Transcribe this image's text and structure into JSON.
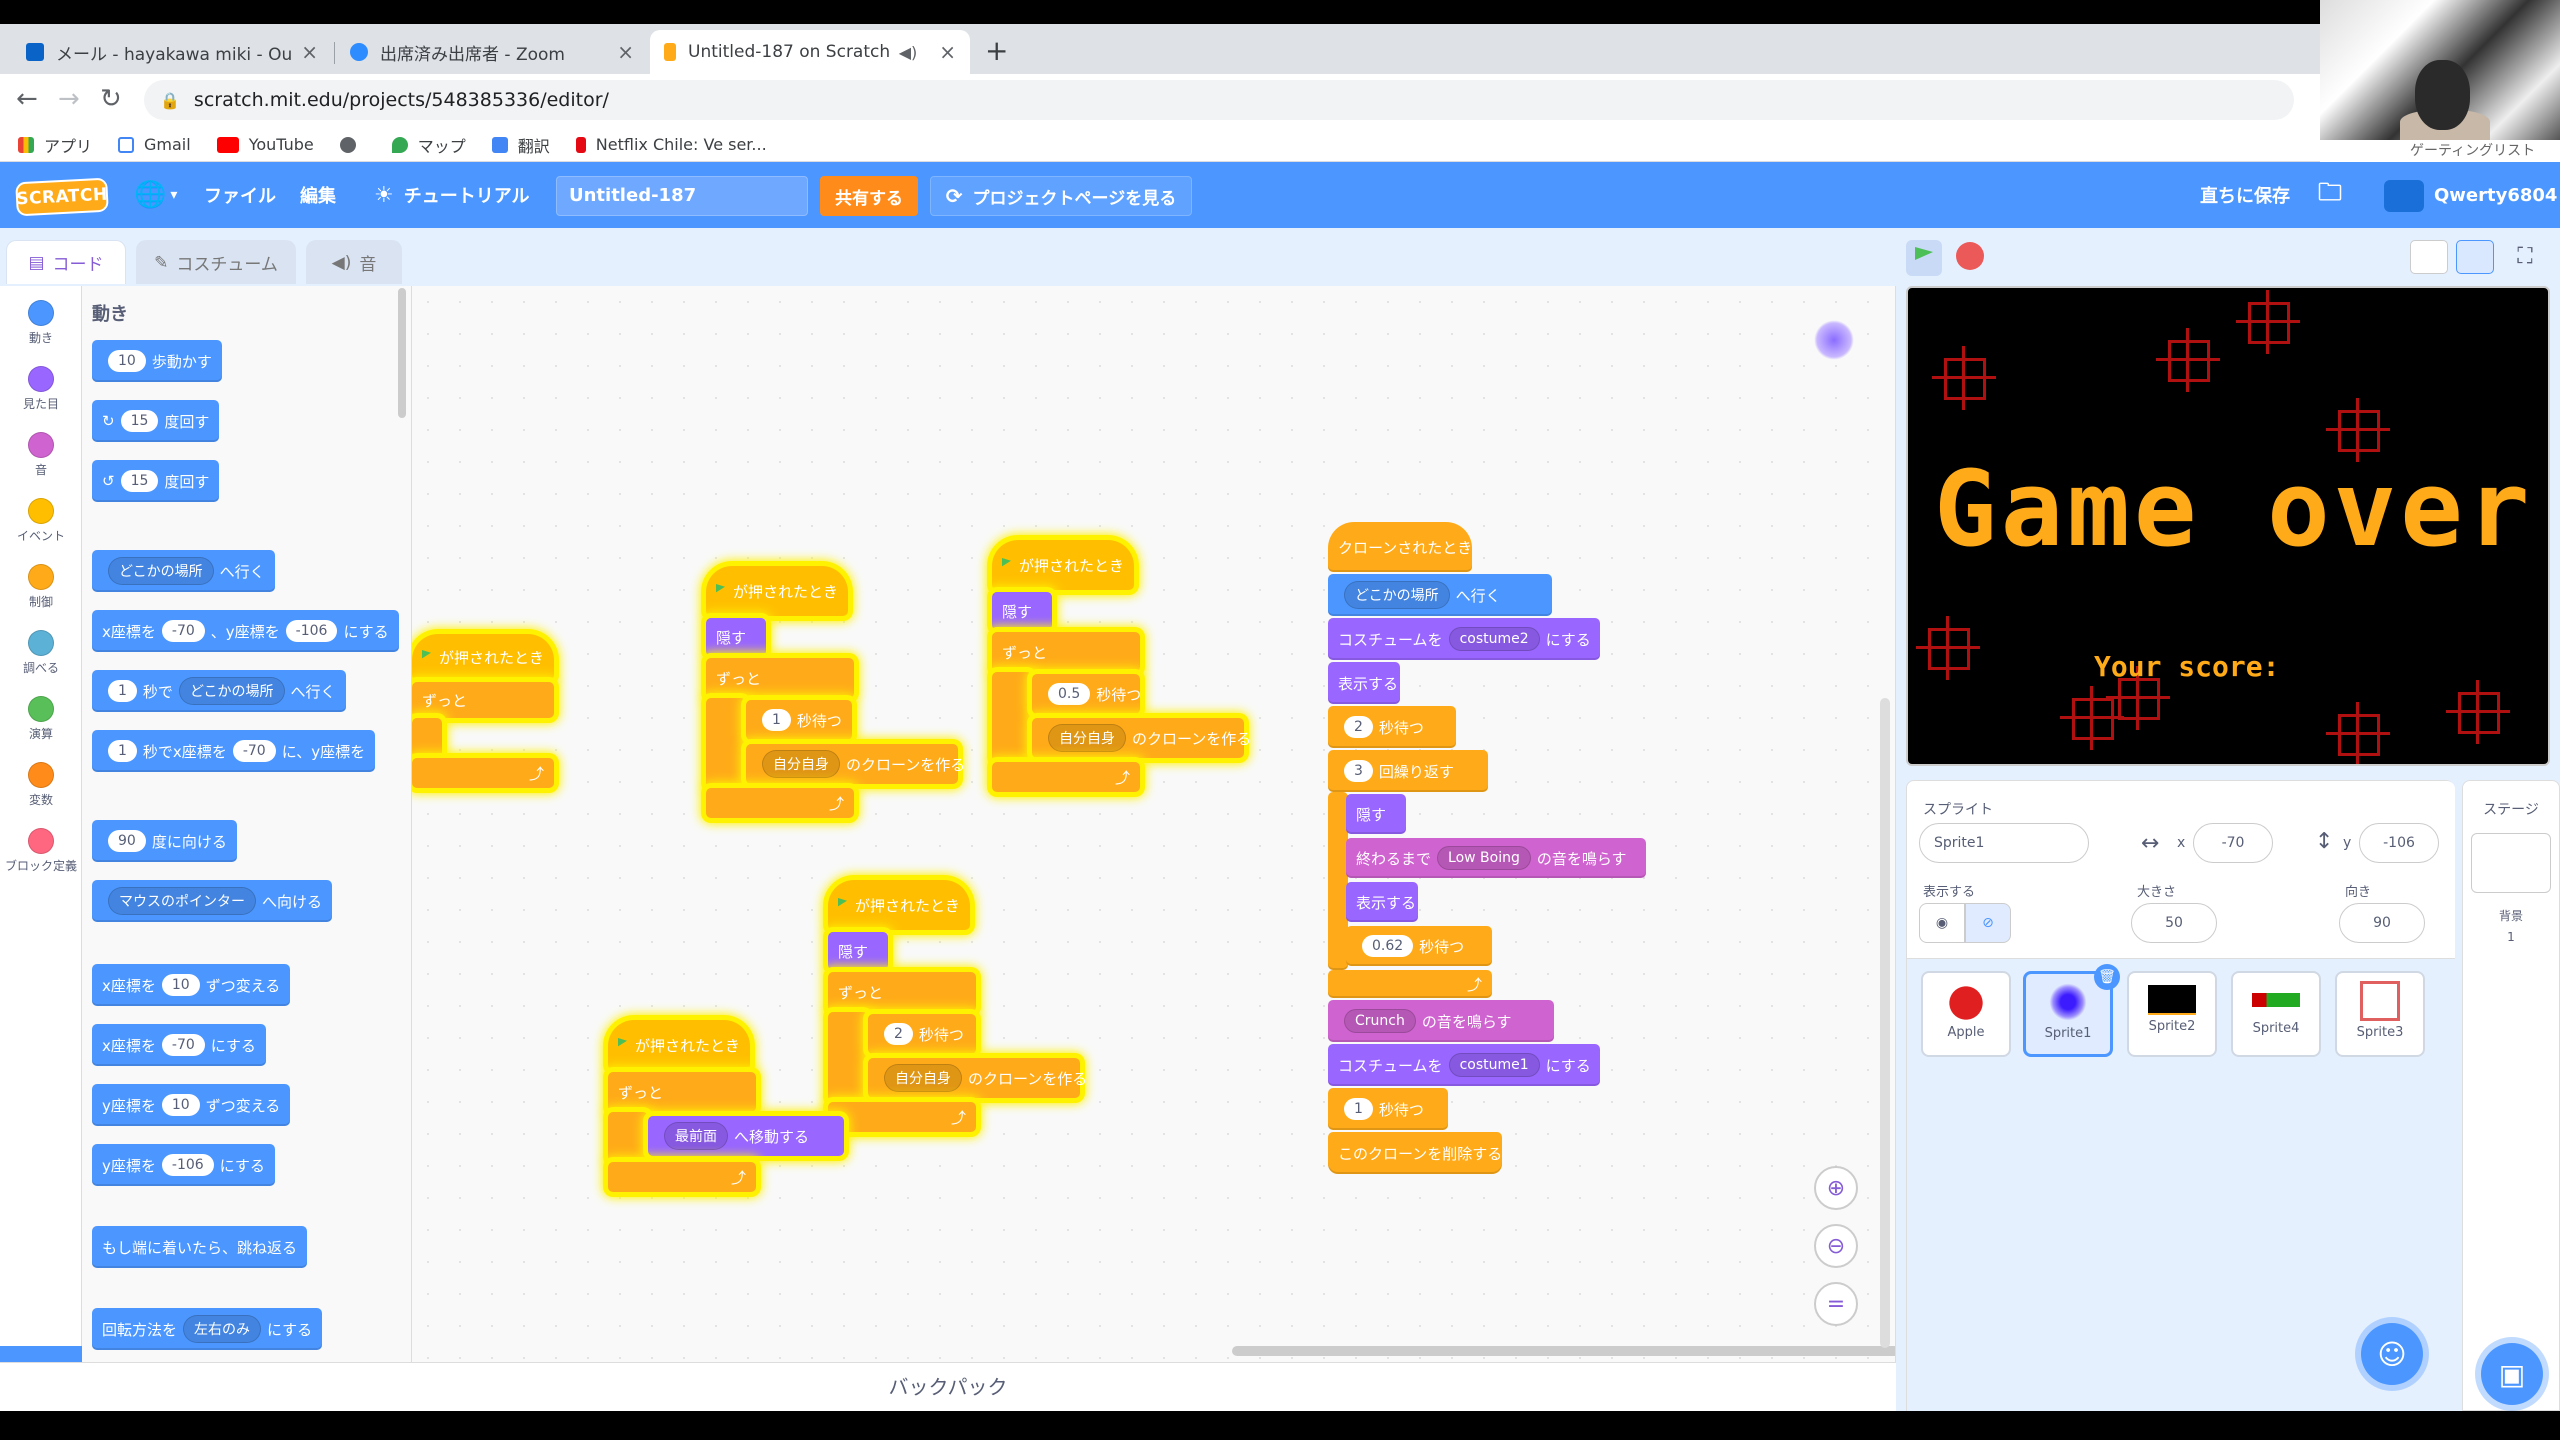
{
  "browser": {
    "tabs": [
      {
        "label": "メール - hayakawa miki - Outlook",
        "icon_color": "#0a64c8"
      },
      {
        "label": "出席済み出席者 - Zoom",
        "icon_color": "#2d8cff"
      },
      {
        "label": "Untitled-187 on Scratch",
        "icon_color": "#ffab19"
      }
    ],
    "url": "scratch.mit.edu/projects/548385336/editor/",
    "bookmarks": [
      {
        "label": "アプリ"
      },
      {
        "label": "Gmail"
      },
      {
        "label": "YouTube"
      },
      {
        "label": ""
      },
      {
        "label": "マップ"
      },
      {
        "label": "翻訳"
      },
      {
        "label": "Netflix Chile: Ve ser..."
      }
    ],
    "webcam_caption": "ゲーティングリスト"
  },
  "menubar": {
    "logo": "SCRATCH",
    "file": "ファイル",
    "edit": "編集",
    "tutorial": "チュートリアル",
    "project_title": "Untitled-187",
    "share": "共有する",
    "see_project": "プロジェクトページを見る",
    "save_now": "直ちに保存",
    "username": "Qwerty6804"
  },
  "editor_tabs": {
    "code": "コード",
    "costumes": "コスチューム",
    "sounds": "音"
  },
  "categories": [
    {
      "label": "動き",
      "color": "#4c97ff"
    },
    {
      "label": "見た目",
      "color": "#9966ff"
    },
    {
      "label": "音",
      "color": "#cf63cf"
    },
    {
      "label": "イベント",
      "color": "#ffbf00"
    },
    {
      "label": "制御",
      "color": "#ffab19"
    },
    {
      "label": "調べる",
      "color": "#5cb1d6"
    },
    {
      "label": "演算",
      "color": "#59c059"
    },
    {
      "label": "変数",
      "color": "#ff8c1a"
    },
    {
      "label": "ブロック定義",
      "color": "#ff6680"
    }
  ],
  "palette": {
    "heading": "動き",
    "move_steps": "10",
    "move_label": "歩動かす",
    "turn_r": "15",
    "turn_label": "度回す",
    "turn_l": "15",
    "goto_target": "どこかの場所",
    "goto_label": "へ行く",
    "gotoxy_x_label": "x座標を",
    "gotoxy_x": "-70",
    "gotoxy_y_label": "、y座標を",
    "gotoxy_y": "-106",
    "gotoxy_end": "にする",
    "glide_secs": "1",
    "glide_label": "秒で",
    "glide_target": "どこかの場所",
    "glide_end": "へ行く",
    "glidexy_secs": "1",
    "glidexy_label": "秒でx座標を",
    "glidexy_x": "-70",
    "glidexy_mid": "に、y座標を",
    "point_dir": "90",
    "point_label": "度に向ける",
    "point_towards": "マウスのポインター",
    "point_towards_label": "へ向ける",
    "changex_label": "x座標を",
    "changex_val": "10",
    "changex_end": "ずつ変える",
    "setx_label": "x座標を",
    "setx_val": "-70",
    "setx_end": "にする",
    "changey_label": "y座標を",
    "changey_val": "10",
    "changey_end": "ずつ変える",
    "sety_label": "y座標を",
    "sety_val": "-106",
    "sety_end": "にする",
    "bounce": "もし端に着いたら、跳ね返る",
    "rotation_label": "回転方法を",
    "rotation_val": "左右のみ",
    "rotation_end": "にする"
  },
  "scripts": {
    "when_flag": "が押されたとき",
    "forever": "ずっと",
    "hide": "隠す",
    "show": "表示する",
    "wait": "秒待つ",
    "myself": "自分自身",
    "create_clone": "のクローンを作る",
    "wait1": "1",
    "wait2": "0.5",
    "wait3": "2",
    "front": "最前面",
    "go_to_layer": "へ移動する",
    "clone_hat": "クローンされたとき",
    "goto_target": "どこかの場所",
    "goto_label": "へ行く",
    "costume_label": "コスチュームを",
    "costume2": "costume2",
    "costume1": "costume1",
    "costume_end": "にする",
    "wait_c1": "2",
    "repeat_n": "3",
    "repeat_label": "回繰り返す",
    "play_until": "終わるまで",
    "sound_low": "Low Boing",
    "play_until_end": "の音を鳴らす",
    "wait_c2": "0.62",
    "sound_crunch": "Crunch",
    "play_sound": "の音を鳴らす",
    "wait_c3": "1",
    "delete_clone": "このクローンを削除する"
  },
  "backpack": "バックパック",
  "stage": {
    "title_text": "Game over",
    "score_text": "Your score:"
  },
  "sprite_info": {
    "sprite_label": "スプライト",
    "sprite_name": "Sprite1",
    "x_label": "x",
    "x": "-70",
    "y_label": "y",
    "y": "-106",
    "show_label": "表示する",
    "size_label": "大きさ",
    "size": "50",
    "direction_label": "向き",
    "direction": "90"
  },
  "sprites": [
    {
      "name": "Apple"
    },
    {
      "name": "Sprite1"
    },
    {
      "name": "Sprite2"
    },
    {
      "name": "Sprite4"
    },
    {
      "name": "Sprite3"
    }
  ],
  "stage_pane": {
    "label": "ステージ",
    "backdrops_label": "背景",
    "backdrops_count": "1"
  }
}
